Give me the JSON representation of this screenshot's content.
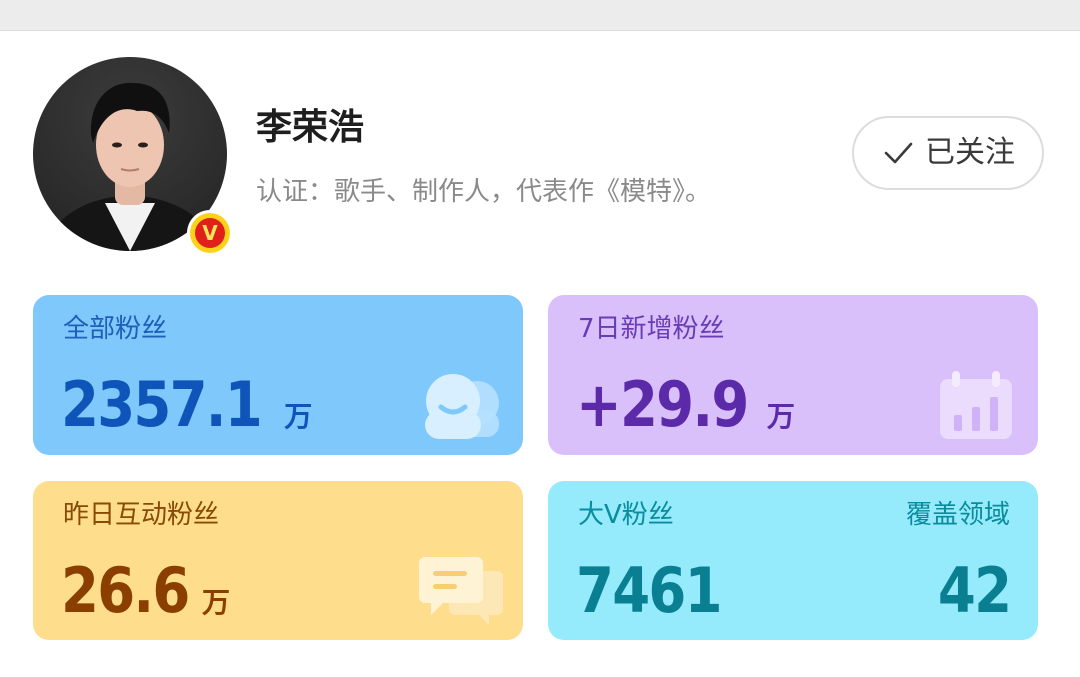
{
  "profile": {
    "name": "李荣浩",
    "certification": "认证：歌手、制作人，代表作《模特》。",
    "verified_badge": "V",
    "follow_button": "已关注"
  },
  "cards": {
    "total_fans": {
      "label": "全部粉丝",
      "value": "2357.1",
      "unit": "万",
      "icon": "fans-icon"
    },
    "new_fans_7d": {
      "label": "7日新增粉丝",
      "value": "+29.9",
      "unit": "万",
      "icon": "calendar-chart-icon"
    },
    "interactive_yesterday": {
      "label": "昨日互动粉丝",
      "value": "26.6",
      "unit": "万",
      "icon": "chat-icon"
    },
    "big_v_fans": {
      "label": "大V粉丝",
      "value": "7461",
      "coverage_label": "覆盖领域",
      "coverage_value": "42"
    }
  },
  "colors": {
    "blue_card": "#7ec8fb",
    "purple_card": "#d9c0fb",
    "yellow_card": "#fedd8c",
    "cyan_card": "#95ebfb",
    "badge_red": "#e0211b",
    "badge_gold": "#ffd21a"
  }
}
